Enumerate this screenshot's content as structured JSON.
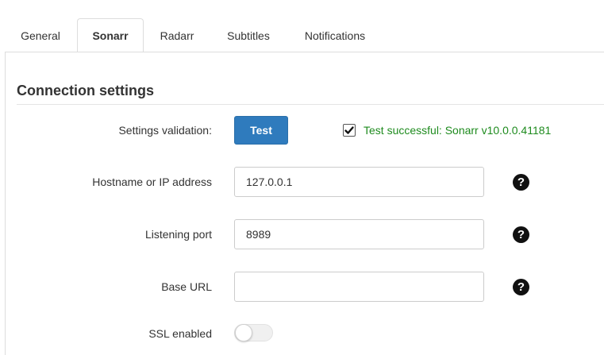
{
  "tabs": [
    {
      "label": "General",
      "active": false
    },
    {
      "label": "Sonarr",
      "active": true
    },
    {
      "label": "Radarr",
      "active": false
    },
    {
      "label": "Subtitles",
      "active": false
    },
    {
      "label": "Notifications",
      "active": false
    }
  ],
  "section": {
    "title": "Connection settings"
  },
  "validation": {
    "label": "Settings validation:",
    "button_label": "Test",
    "checked": true,
    "status_text": "Test successful: Sonarr v10.0.0.41181",
    "status_color": "#1e8b1e"
  },
  "fields": {
    "hostname": {
      "label": "Hostname or IP address",
      "value": "127.0.0.1",
      "help_icon": "question-circle-icon"
    },
    "port": {
      "label": "Listening port",
      "value": "8989",
      "help_icon": "question-circle-icon"
    },
    "base_url": {
      "label": "Base URL",
      "value": "",
      "help_icon": "question-circle-icon"
    },
    "ssl": {
      "label": "SSL enabled",
      "enabled": false
    }
  },
  "colors": {
    "accent": "#2f7bbd",
    "success": "#1e8b1e",
    "border": "#dddddd"
  }
}
